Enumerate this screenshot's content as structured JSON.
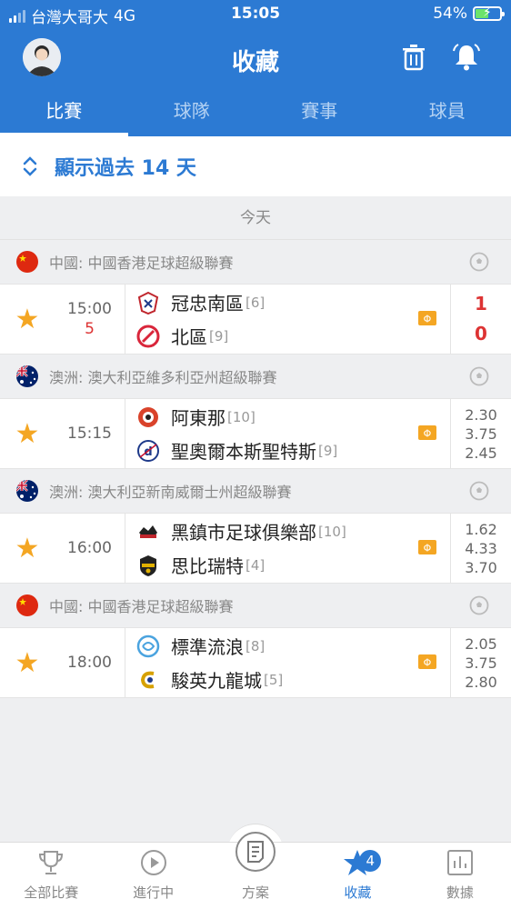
{
  "status": {
    "carrier": "台灣大哥大",
    "network": "4G",
    "time": "15:05",
    "battery": "54%",
    "battery_level": 0.54
  },
  "header": {
    "title": "收藏",
    "avatar_icon": "avatar-icon",
    "trash_icon": "trash-icon",
    "bell_icon": "bell-icon"
  },
  "tabs": [
    {
      "label": "比賽",
      "active": true
    },
    {
      "label": "球隊",
      "active": false
    },
    {
      "label": "賽事",
      "active": false
    },
    {
      "label": "球員",
      "active": false
    }
  ],
  "filter": {
    "label": "顯示過去 14 天"
  },
  "day_label": "今天",
  "leagues": [
    {
      "name": "中國: 中國香港足球超級聯賽",
      "flag": "china",
      "match": {
        "time": "15:00",
        "minute": "5",
        "home": {
          "name": "冠忠南區",
          "rank": "[6]",
          "logo_color": "#c0262d"
        },
        "away": {
          "name": "北區",
          "rank": "[9]",
          "logo_color": "#d9263b"
        },
        "scores": [
          "1",
          "0"
        ],
        "odds": []
      }
    },
    {
      "name": "澳洲: 澳大利亞維多利亞州超級聯賽",
      "flag": "australia",
      "match": {
        "time": "15:15",
        "minute": "",
        "home": {
          "name": "阿東那",
          "rank": "[10]",
          "logo_color": "#d9432b"
        },
        "away": {
          "name": "聖奧爾本斯聖特斯",
          "rank": "[9]",
          "logo_color": "#1e3a8a"
        },
        "scores": [],
        "odds": [
          "2.30",
          "3.75",
          "2.45"
        ]
      }
    },
    {
      "name": "澳洲: 澳大利亞新南威爾士州超級聯賽",
      "flag": "australia",
      "match": {
        "time": "16:00",
        "minute": "",
        "home": {
          "name": "黑鎮市足球俱樂部",
          "rank": "[10]",
          "logo_color": "#c0262d"
        },
        "away": {
          "name": "思比瑞特",
          "rank": "[4]",
          "logo_color": "#e2b100"
        },
        "scores": [],
        "odds": [
          "1.62",
          "4.33",
          "3.70"
        ]
      }
    },
    {
      "name": "中國: 中國香港足球超級聯賽",
      "flag": "china",
      "match": {
        "time": "18:00",
        "minute": "",
        "home": {
          "name": "標準流浪",
          "rank": "[8]",
          "logo_color": "#4aa3df"
        },
        "away": {
          "name": "駿英九龍城",
          "rank": "[5]",
          "logo_color": "#d7a100"
        },
        "scores": [],
        "odds": [
          "2.05",
          "3.75",
          "2.80"
        ]
      }
    }
  ],
  "bottom_nav": [
    {
      "label": "全部比賽",
      "icon": "trophy-icon",
      "active": false
    },
    {
      "label": "進行中",
      "icon": "play-icon",
      "active": false
    },
    {
      "label": "方案",
      "icon": "document-icon",
      "active": false
    },
    {
      "label": "收藏",
      "icon": "star-icon",
      "active": true,
      "badge": "4"
    },
    {
      "label": "數據",
      "icon": "chart-icon",
      "active": false
    }
  ],
  "colors": {
    "accent": "#2c7ad3",
    "star": "#f4a623",
    "score": "#dd3333",
    "odds_icon": "#f4a623"
  }
}
